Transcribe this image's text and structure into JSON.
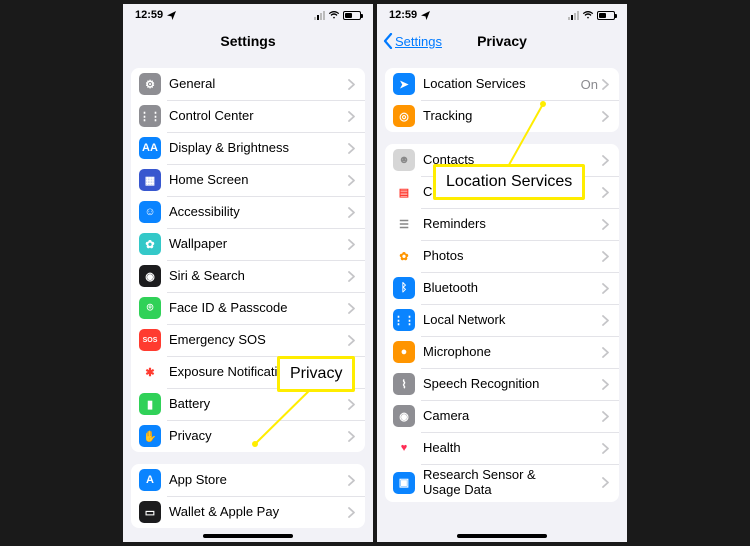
{
  "status": {
    "time": "12:59"
  },
  "left_phone": {
    "nav_title": "Settings",
    "groups": [
      {
        "rows": [
          {
            "label": "General",
            "icon_name": "gear-icon",
            "bg": "#8e8e93",
            "glyph": "⚙"
          },
          {
            "label": "Control Center",
            "icon_name": "toggles-icon",
            "bg": "#8e8e93",
            "glyph": "⋮⋮"
          },
          {
            "label": "Display & Brightness",
            "icon_name": "text-size-icon",
            "bg": "#0a84ff",
            "glyph": "AA"
          },
          {
            "label": "Home Screen",
            "icon_name": "grid-icon",
            "bg": "#3857cf",
            "glyph": "▦"
          },
          {
            "label": "Accessibility",
            "icon_name": "person-icon",
            "bg": "#0a84ff",
            "glyph": "☺"
          },
          {
            "label": "Wallpaper",
            "icon_name": "flower-icon",
            "bg": "#34c8c8",
            "glyph": "✿"
          },
          {
            "label": "Siri & Search",
            "icon_name": "siri-icon",
            "bg": "#1c1c1e",
            "glyph": "◉"
          },
          {
            "label": "Face ID & Passcode",
            "icon_name": "faceid-icon",
            "bg": "#30d158",
            "glyph": "⌾"
          },
          {
            "label": "Emergency SOS",
            "icon_name": "sos-icon",
            "bg": "#ff3b30",
            "glyph": "SOS"
          },
          {
            "label": "Exposure Notifications",
            "icon_name": "exposure-icon",
            "bg": "#ffffff",
            "glyph": "✱",
            "glyph_color": "#ff3b30"
          },
          {
            "label": "Battery",
            "icon_name": "battery-icon",
            "bg": "#30d158",
            "glyph": "▮"
          },
          {
            "label": "Privacy",
            "icon_name": "hand-icon",
            "bg": "#0a84ff",
            "glyph": "✋"
          }
        ]
      },
      {
        "rows": [
          {
            "label": "App Store",
            "icon_name": "appstore-icon",
            "bg": "#0a84ff",
            "glyph": "A"
          },
          {
            "label": "Wallet & Apple Pay",
            "icon_name": "wallet-icon",
            "bg": "#1c1c1e",
            "glyph": "▭"
          }
        ]
      }
    ]
  },
  "right_phone": {
    "nav_back": "Settings",
    "nav_title": "Privacy",
    "groups": [
      {
        "rows": [
          {
            "label": "Location Services",
            "value": "On",
            "icon_name": "location-icon",
            "bg": "#0a84ff",
            "glyph": "➤"
          },
          {
            "label": "Tracking",
            "icon_name": "tracking-icon",
            "bg": "#ff9500",
            "glyph": "◎"
          }
        ]
      },
      {
        "rows": [
          {
            "label": "Contacts",
            "icon_name": "contacts-icon",
            "bg": "#d6d6d6",
            "glyph": "☻",
            "glyph_color": "#888"
          },
          {
            "label": "Calendars",
            "icon_name": "calendar-icon",
            "bg": "#ffffff",
            "glyph": "▤",
            "glyph_color": "#ff3b30"
          },
          {
            "label": "Reminders",
            "icon_name": "reminders-icon",
            "bg": "#ffffff",
            "glyph": "☰",
            "glyph_color": "#888"
          },
          {
            "label": "Photos",
            "icon_name": "photos-icon",
            "bg": "#ffffff",
            "glyph": "✿",
            "glyph_color": "#ff9500"
          },
          {
            "label": "Bluetooth",
            "icon_name": "bluetooth-icon",
            "bg": "#0a84ff",
            "glyph": "ᛒ"
          },
          {
            "label": "Local Network",
            "icon_name": "network-icon",
            "bg": "#0a84ff",
            "glyph": "⋮⋮"
          },
          {
            "label": "Microphone",
            "icon_name": "mic-icon",
            "bg": "#ff9500",
            "glyph": "●"
          },
          {
            "label": "Speech Recognition",
            "icon_name": "speech-icon",
            "bg": "#8e8e93",
            "glyph": "⌇"
          },
          {
            "label": "Camera",
            "icon_name": "camera-icon",
            "bg": "#8e8e93",
            "glyph": "◉"
          },
          {
            "label": "Health",
            "icon_name": "health-icon",
            "bg": "#ffffff",
            "glyph": "♥",
            "glyph_color": "#ff2d55"
          },
          {
            "label": "Research Sensor &\nUsage Data",
            "icon_name": "research-icon",
            "bg": "#0a84ff",
            "glyph": "▣"
          }
        ]
      }
    ]
  },
  "callouts": {
    "privacy": "Privacy",
    "location_services": "Location Services"
  }
}
